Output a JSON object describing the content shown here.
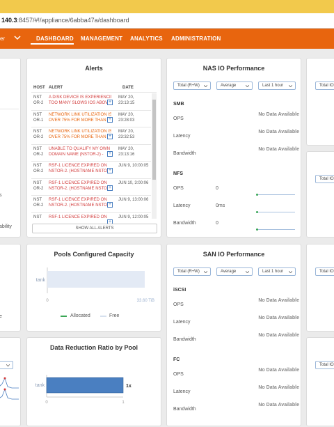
{
  "browser": {
    "url_host": "140.3",
    "url_path": ":8457/#!/appliance/6abba47a/dashboard"
  },
  "nav": {
    "context_label": "er",
    "items": [
      "DASHBOARD",
      "MANAGEMENT",
      "ANALYTICS",
      "ADMINISTRATION"
    ]
  },
  "left_partial": {
    "text1": "s",
    "text2": "ability",
    "text3": "e"
  },
  "alerts": {
    "title": "Alerts",
    "headers": {
      "host": "HOST",
      "alert": "ALERT",
      "date": "DATE"
    },
    "rows": [
      {
        "host1": "NST",
        "host2": "OR-2",
        "msg1": "A DISK DEVICE IS EXPERIENCING",
        "msg2": "TOO MANY SLOWS IOS ABOV",
        "date1": "MAY 20,",
        "date2": "23:13:15",
        "color": "red"
      },
      {
        "host1": "NST",
        "host2": "OR-1",
        "msg1": "NETWORK LINK UTILIZATION IS",
        "msg2": "OVER 75% FOR MORE THAN",
        "date1": "MAY 20,",
        "date2": "23:28:03",
        "color": "orange"
      },
      {
        "host1": "NST",
        "host2": "OR-2",
        "msg1": "NETWORK LINK UTILIZATION IS",
        "msg2": "OVER 75% FOR MORE THAN",
        "date1": "MAY 20,",
        "date2": "23:32:53",
        "color": "orange"
      },
      {
        "host1": "NST",
        "host2": "OR-2",
        "msg1": "UNABLE TO QUALIFY MY OWN",
        "msg2": "DOMAIN NAME (NSTOR-2) -",
        "date1": "MAY 20,",
        "date2": "23:13:16",
        "color": "red"
      },
      {
        "host1": "NST",
        "host2": "OR-2",
        "msg1": "RSF-1 LICENCE EXPIRED ON",
        "msg2": "NSTOR-2. (HOSTNAME NSTOI",
        "date1": "JUN 9, 10:00:05",
        "date2": "",
        "color": "red"
      },
      {
        "host1": "NST",
        "host2": "OR-2",
        "msg1": "RSF-1 LICENCE EXPIRED ON",
        "msg2": "NSTOR-2. (HOSTNAME NSTOI",
        "date1": "JUN 10, 3:00:06",
        "date2": "",
        "color": "red"
      },
      {
        "host1": "NST",
        "host2": "OR-2",
        "msg1": "RSF-1 LICENCE EXPIRED ON",
        "msg2": "NSTOR-2. (HOSTNAME NSTOI",
        "date1": "JUN 9, 13:00:06",
        "date2": "",
        "color": "red"
      },
      {
        "host1": "NST",
        "host2": "",
        "msg1": "RSF-1 LICENCE EXPIRED ON",
        "msg2": "",
        "date1": "JUN 9, 12:00:05",
        "date2": "",
        "color": "red"
      }
    ],
    "button": "SHOW ALL ALERTS"
  },
  "nas": {
    "title": "NAS IO Performance",
    "selects": [
      "Total (R+W)",
      "Average",
      "Last 1 hour"
    ],
    "smb": {
      "label": "SMB",
      "ops": "OPS",
      "latency": "Latency",
      "bandwidth": "Bandwidth",
      "nodata": "No Data Available"
    },
    "nfs": {
      "label": "NFS",
      "ops": "OPS",
      "ops_value": "0",
      "latency": "Latency",
      "latency_value": "0ms",
      "bandwidth": "Bandwidth",
      "bandwidth_value": "0"
    }
  },
  "right_partial": {
    "select1": "Total IO",
    "select2": "Total IO",
    "select3": "Total IO",
    "select4": "Total IO"
  },
  "pools": {
    "title": "Pools Configured Capacity",
    "pool_name": "tank",
    "axis_min": "0",
    "axis_max": "33.60 TiB",
    "legend_allocated": "Allocated",
    "legend_free": "Free"
  },
  "san": {
    "title": "SAN IO Performance",
    "selects": [
      "Total (R+W)",
      "Average",
      "Last 1 hour"
    ],
    "iscsi": {
      "label": "iSCSI",
      "ops": "OPS",
      "latency": "Latency",
      "bandwidth": "Bandwidth"
    },
    "fc": {
      "label": "FC",
      "ops": "OPS",
      "latency": "Latency",
      "bandwidth": "Bandwidth"
    },
    "nodata": "No Data Available"
  },
  "reduction": {
    "title": "Data Reduction Ratio by Pool",
    "pool_name": "tank",
    "value_label": "1x",
    "axis_min": "0",
    "axis_max": "1"
  },
  "chart_data": [
    {
      "type": "bar",
      "title": "Pools Configured Capacity",
      "categories": [
        "tank"
      ],
      "series": [
        {
          "name": "Allocated",
          "values": [
            0
          ]
        },
        {
          "name": "Free",
          "values": [
            33.6
          ]
        }
      ],
      "xlim": [
        0,
        33.6
      ],
      "xlabel": "",
      "ylabel": "",
      "legend": "bottom"
    },
    {
      "type": "bar",
      "title": "Data Reduction Ratio by Pool",
      "categories": [
        "tank"
      ],
      "values": [
        1
      ],
      "xlim": [
        0,
        1
      ],
      "xlabel": "",
      "ylabel": ""
    }
  ],
  "colors": {
    "nav": "#e8650e",
    "allocated": "#3aa655",
    "free": "#e3eaf5",
    "reduction_bar": "#4a7fc1",
    "alert_red": "#d23c3c",
    "alert_orange": "#e8650e"
  }
}
